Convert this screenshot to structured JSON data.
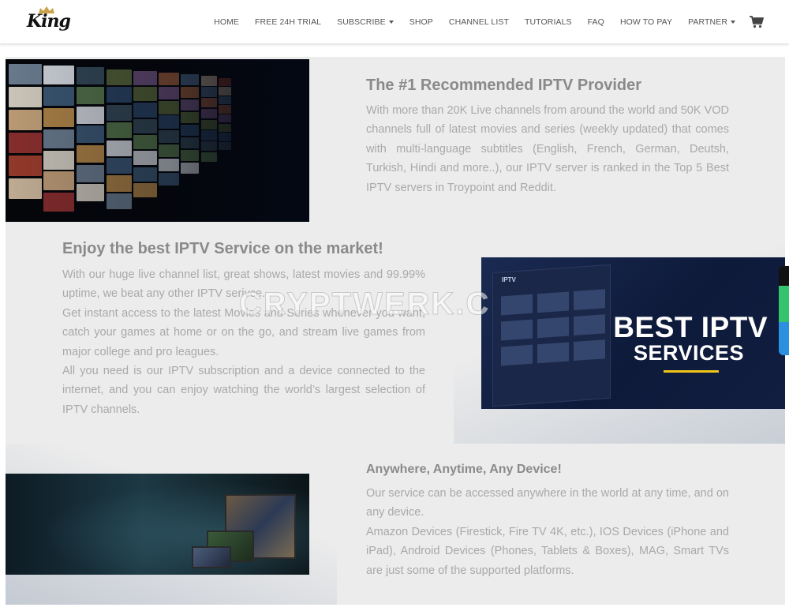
{
  "header": {
    "logo_text": "King",
    "nav": [
      {
        "label": "HOME",
        "dropdown": false
      },
      {
        "label": "FREE 24H TRIAL",
        "dropdown": false
      },
      {
        "label": "SUBSCRIBE",
        "dropdown": true
      },
      {
        "label": "SHOP",
        "dropdown": false
      },
      {
        "label": "CHANNEL LIST",
        "dropdown": false
      },
      {
        "label": "TUTORIALS",
        "dropdown": false
      },
      {
        "label": "FAQ",
        "dropdown": false
      },
      {
        "label": "HOW TO PAY",
        "dropdown": false
      },
      {
        "label": "PARTNER",
        "dropdown": true
      }
    ],
    "cart_icon": "shopping-cart-icon"
  },
  "section1": {
    "title": "The #1 Recommended IPTV Provider",
    "body": "With more than 20K Live channels from around the world and 50K VOD channels full of latest movies and series (weekly updated) that comes with multi-language subtitles (English, French, German, Deutsh, Turkish, Hindi and more..), our IPTV server is ranked in the Top 5 Best IPTV servers in Troypoint and Reddit."
  },
  "section2": {
    "title": "Enjoy the best IPTV Service on the market!",
    "paragraphs": [
      "With our huge live channel list, great shows, latest movies and 99.99% uptime, we beat any other IPTV serivce.",
      "Get instant access to the latest Movies and Series whenever you want, catch your games at home or on the go, and stream live games from major college and pro leagues.",
      "All you need is our IPTV subscription and a device connected to the internet, and you can enjoy watching the world’s largest selection of IPTV channels."
    ],
    "image_line1": "BEST IPTV",
    "image_line2": "SERVICES",
    "image_small_label": "IPTV"
  },
  "section3": {
    "title": "Anywhere, Anytime, Any Device!",
    "paragraphs": [
      "Our service can be accessed anywhere in the world at any time, and on any device.",
      "Amazon Devices (Firestick, Fire TV 4K, etc.), IOS Devices (iPhone and iPad), Android Devices (Phones, Tablets & Boxes), MAG, Smart TVs are just some of the supported platforms."
    ]
  },
  "watermark": "CRYPTWERK.C",
  "colors": {
    "heading": "#8a8a8a",
    "body_text": "#a9a9a9",
    "section_bg": "#ececec",
    "accent_yellow": "#f0c419",
    "side_green": "#35c36b",
    "side_blue": "#2d8fe0"
  }
}
